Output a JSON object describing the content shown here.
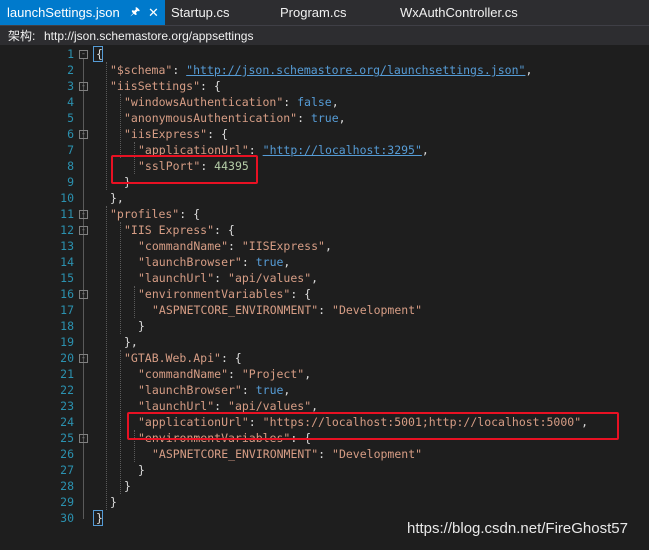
{
  "tabs": [
    {
      "label": "launchSettings.json",
      "active": true,
      "pin_icon": "pin-icon",
      "close_icon": "close-icon"
    },
    {
      "label": "Startup.cs",
      "active": false
    },
    {
      "label": "Program.cs",
      "active": false
    },
    {
      "label": "WxAuthController.cs",
      "active": false
    }
  ],
  "schema_bar": {
    "label": "架构:",
    "value": "http://json.schemastore.org/appsettings"
  },
  "code_lines": [
    {
      "n": "1",
      "t": [
        [
          "p",
          "{"
        ]
      ]
    },
    {
      "n": "2",
      "t": [
        [
          "k",
          "\"$schema\""
        ],
        [
          "p",
          ": "
        ],
        [
          "u",
          "\"http://json.schemastore.org/launchsettings.json\""
        ],
        [
          "p",
          ","
        ]
      ]
    },
    {
      "n": "3",
      "t": [
        [
          "k",
          "\"iisSettings\""
        ],
        [
          "p",
          ": {"
        ]
      ]
    },
    {
      "n": "4",
      "t": [
        [
          "k",
          "\"windowsAuthentication\""
        ],
        [
          "p",
          ": "
        ],
        [
          "b",
          "false"
        ],
        [
          "p",
          ","
        ]
      ]
    },
    {
      "n": "5",
      "t": [
        [
          "k",
          "\"anonymousAuthentication\""
        ],
        [
          "p",
          ": "
        ],
        [
          "b",
          "true"
        ],
        [
          "p",
          ","
        ]
      ]
    },
    {
      "n": "6",
      "t": [
        [
          "k",
          "\"iisExpress\""
        ],
        [
          "p",
          ": {"
        ]
      ]
    },
    {
      "n": "7",
      "t": [
        [
          "k",
          "\"applicationUrl\""
        ],
        [
          "p",
          ": "
        ],
        [
          "u",
          "\"http://localhost:3295\""
        ],
        [
          "p",
          ","
        ]
      ]
    },
    {
      "n": "8",
      "t": [
        [
          "k",
          "\"sslPort\""
        ],
        [
          "p",
          ": "
        ],
        [
          "n",
          "44395"
        ]
      ]
    },
    {
      "n": "9",
      "t": [
        [
          "p",
          "}"
        ]
      ]
    },
    {
      "n": "10",
      "t": [
        [
          "p",
          "},"
        ]
      ]
    },
    {
      "n": "11",
      "t": [
        [
          "k",
          "\"profiles\""
        ],
        [
          "p",
          ": {"
        ]
      ]
    },
    {
      "n": "12",
      "t": [
        [
          "k",
          "\"IIS Express\""
        ],
        [
          "p",
          ": {"
        ]
      ]
    },
    {
      "n": "13",
      "t": [
        [
          "k",
          "\"commandName\""
        ],
        [
          "p",
          ": "
        ],
        [
          "s",
          "\"IISExpress\""
        ],
        [
          "p",
          ","
        ]
      ]
    },
    {
      "n": "14",
      "t": [
        [
          "k",
          "\"launchBrowser\""
        ],
        [
          "p",
          ": "
        ],
        [
          "b",
          "true"
        ],
        [
          "p",
          ","
        ]
      ]
    },
    {
      "n": "15",
      "t": [
        [
          "k",
          "\"launchUrl\""
        ],
        [
          "p",
          ": "
        ],
        [
          "s",
          "\"api/values\""
        ],
        [
          "p",
          ","
        ]
      ]
    },
    {
      "n": "16",
      "t": [
        [
          "k",
          "\"environmentVariables\""
        ],
        [
          "p",
          ": {"
        ]
      ]
    },
    {
      "n": "17",
      "t": [
        [
          "k",
          "\"ASPNETCORE_ENVIRONMENT\""
        ],
        [
          "p",
          ": "
        ],
        [
          "s",
          "\"Development\""
        ]
      ]
    },
    {
      "n": "18",
      "t": [
        [
          "p",
          "}"
        ]
      ]
    },
    {
      "n": "19",
      "t": [
        [
          "p",
          "},"
        ]
      ]
    },
    {
      "n": "20",
      "t": [
        [
          "k",
          "\"GTAB.Web.Api\""
        ],
        [
          "p",
          ": {"
        ]
      ]
    },
    {
      "n": "21",
      "t": [
        [
          "k",
          "\"commandName\""
        ],
        [
          "p",
          ": "
        ],
        [
          "s",
          "\"Project\""
        ],
        [
          "p",
          ","
        ]
      ]
    },
    {
      "n": "22",
      "t": [
        [
          "k",
          "\"launchBrowser\""
        ],
        [
          "p",
          ": "
        ],
        [
          "b",
          "true"
        ],
        [
          "p",
          ","
        ]
      ]
    },
    {
      "n": "23",
      "t": [
        [
          "k",
          "\"launchUrl\""
        ],
        [
          "p",
          ": "
        ],
        [
          "s",
          "\"api/values\""
        ],
        [
          "p",
          ","
        ]
      ]
    },
    {
      "n": "24",
      "t": [
        [
          "k",
          "\"applicationUrl\""
        ],
        [
          "p",
          ": "
        ],
        [
          "s",
          "\"https://localhost:5001;http://localhost:5000\""
        ],
        [
          "p",
          ","
        ]
      ]
    },
    {
      "n": "25",
      "t": [
        [
          "k",
          "\"environmentVariables\""
        ],
        [
          "p",
          ": {"
        ]
      ]
    },
    {
      "n": "26",
      "t": [
        [
          "k",
          "\"ASPNETCORE_ENVIRONMENT\""
        ],
        [
          "p",
          ": "
        ],
        [
          "s",
          "\"Development\""
        ]
      ]
    },
    {
      "n": "27",
      "t": [
        [
          "p",
          "}"
        ]
      ]
    },
    {
      "n": "28",
      "t": [
        [
          "p",
          "}"
        ]
      ]
    },
    {
      "n": "29",
      "t": [
        [
          "p",
          "}"
        ]
      ]
    },
    {
      "n": "30",
      "t": [
        [
          "p",
          "}"
        ]
      ]
    }
  ],
  "watermark": "https://blog.csdn.net/FireGhost57",
  "colors": {
    "accent": "#007acc",
    "highlight_box": "#e81123",
    "key_string": "#d69d85",
    "keyword": "#569cd6",
    "number": "#b5cea8",
    "line_number": "#2b91af"
  }
}
